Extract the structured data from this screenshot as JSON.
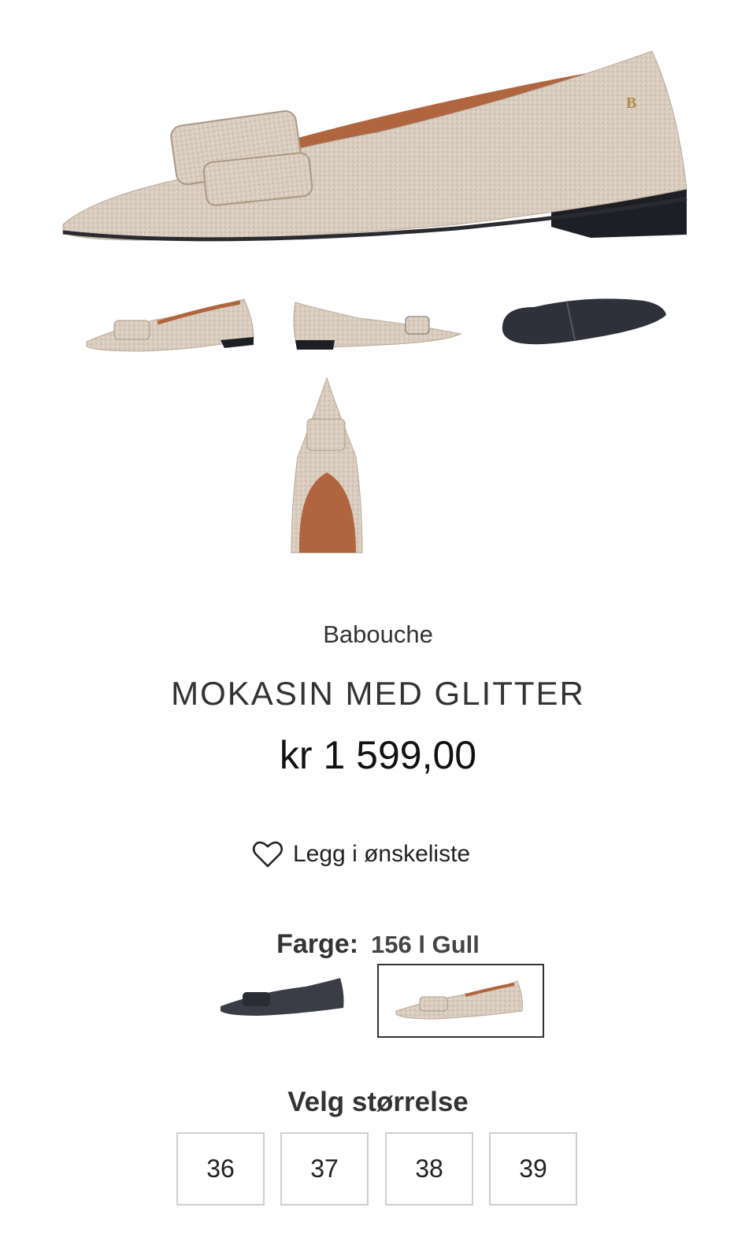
{
  "product": {
    "brand": "Babouche",
    "title": "MOKASIN MED GLITTER",
    "price": "kr 1 599,00",
    "main_image": "glitter-pointed-flat-side-view",
    "thumbnails": [
      {
        "icon": "shoe-side-left-thumbnail"
      },
      {
        "icon": "shoe-side-right-thumbnail"
      },
      {
        "icon": "shoe-sole-thumbnail"
      },
      {
        "icon": "shoe-top-view-thumbnail"
      }
    ]
  },
  "wishlist": {
    "label": "Legg i ønskeliste",
    "icon": "heart-icon"
  },
  "color": {
    "label": "Farge:",
    "selected": "156 l Gull",
    "options": [
      {
        "icon": "black-shoe-swatch",
        "color": "#3a3d46"
      },
      {
        "icon": "gold-shoe-swatch",
        "color": "#d8cbbd",
        "selected": true
      }
    ]
  },
  "sizes": {
    "heading": "Velg størrelse",
    "options": [
      "36",
      "37",
      "38",
      "39"
    ]
  },
  "colors": {
    "glitter": "#d8cbbd",
    "glitter_dark": "#c2b4a4",
    "lining": "#b0653f",
    "sole": "#1d1f24"
  }
}
